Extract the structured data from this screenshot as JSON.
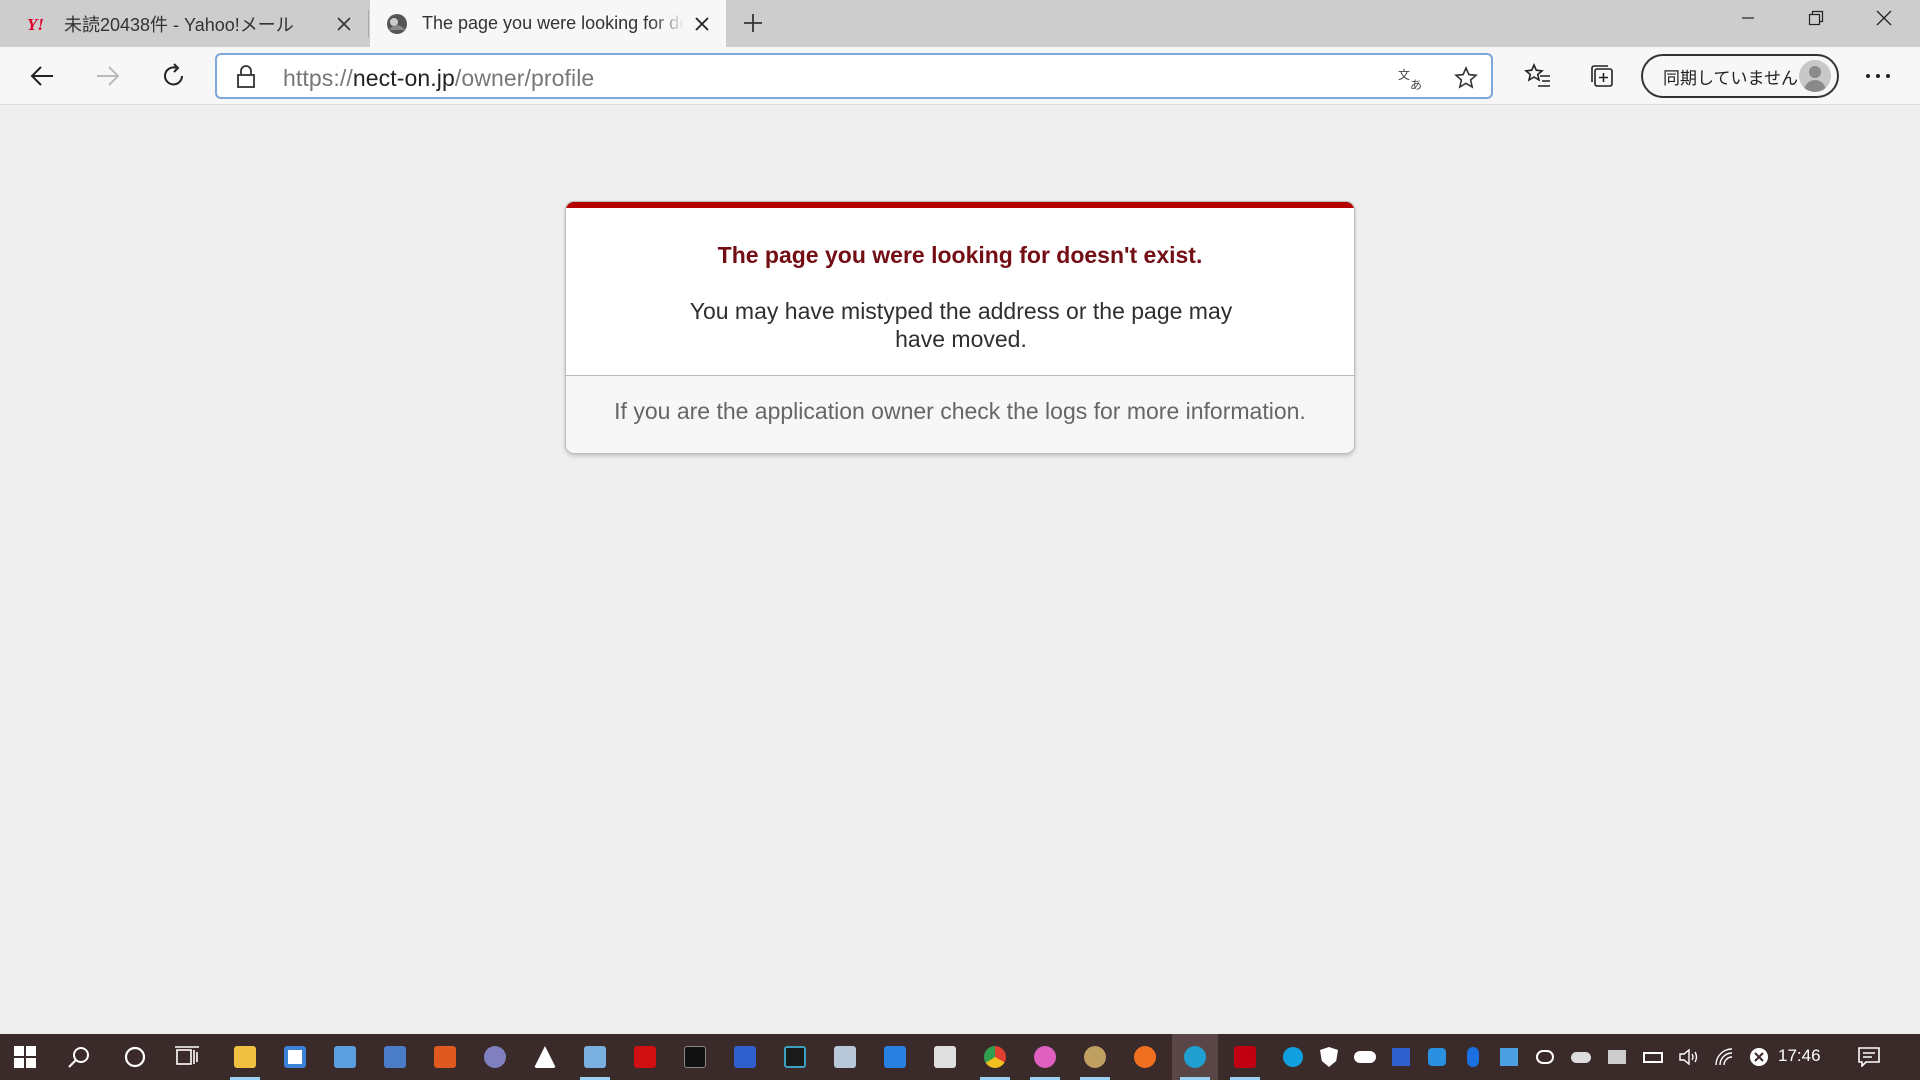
{
  "tabs": [
    {
      "title": "未読20438件 - Yahoo!メール",
      "favicon": "yahoo-icon",
      "active": false
    },
    {
      "title": "The page you were looking for doesn't exist",
      "favicon": "site-icon",
      "active": true
    }
  ],
  "toolbar": {
    "url_scheme": "https://",
    "url_host": "nect-on.jp",
    "url_path": "/owner/profile",
    "sync_label": "同期していません"
  },
  "error": {
    "heading": "The page you were looking for doesn't exist.",
    "message": "You may have mistyped the address or the page may have moved.",
    "footer": "If you are the application owner check the logs for more information."
  },
  "colors": {
    "accent_red": "#b50000",
    "heading_color": "#730e15",
    "taskbar": "#3b2a2a"
  },
  "taskbar": {
    "apps": [
      "file-explorer-icon",
      "store-icon",
      "app-icon",
      "app-icon",
      "app-icon",
      "app-icon",
      "app-icon",
      "app-icon",
      "app-icon",
      "app-icon",
      "terminal-icon",
      "app-icon",
      "app-icon",
      "app-icon",
      "mail-icon",
      "app-icon",
      "chrome-icon",
      "itunes-icon",
      "app-icon",
      "firefox-icon",
      "edge-icon",
      "mcafee-icon"
    ],
    "clock": "17:46"
  }
}
